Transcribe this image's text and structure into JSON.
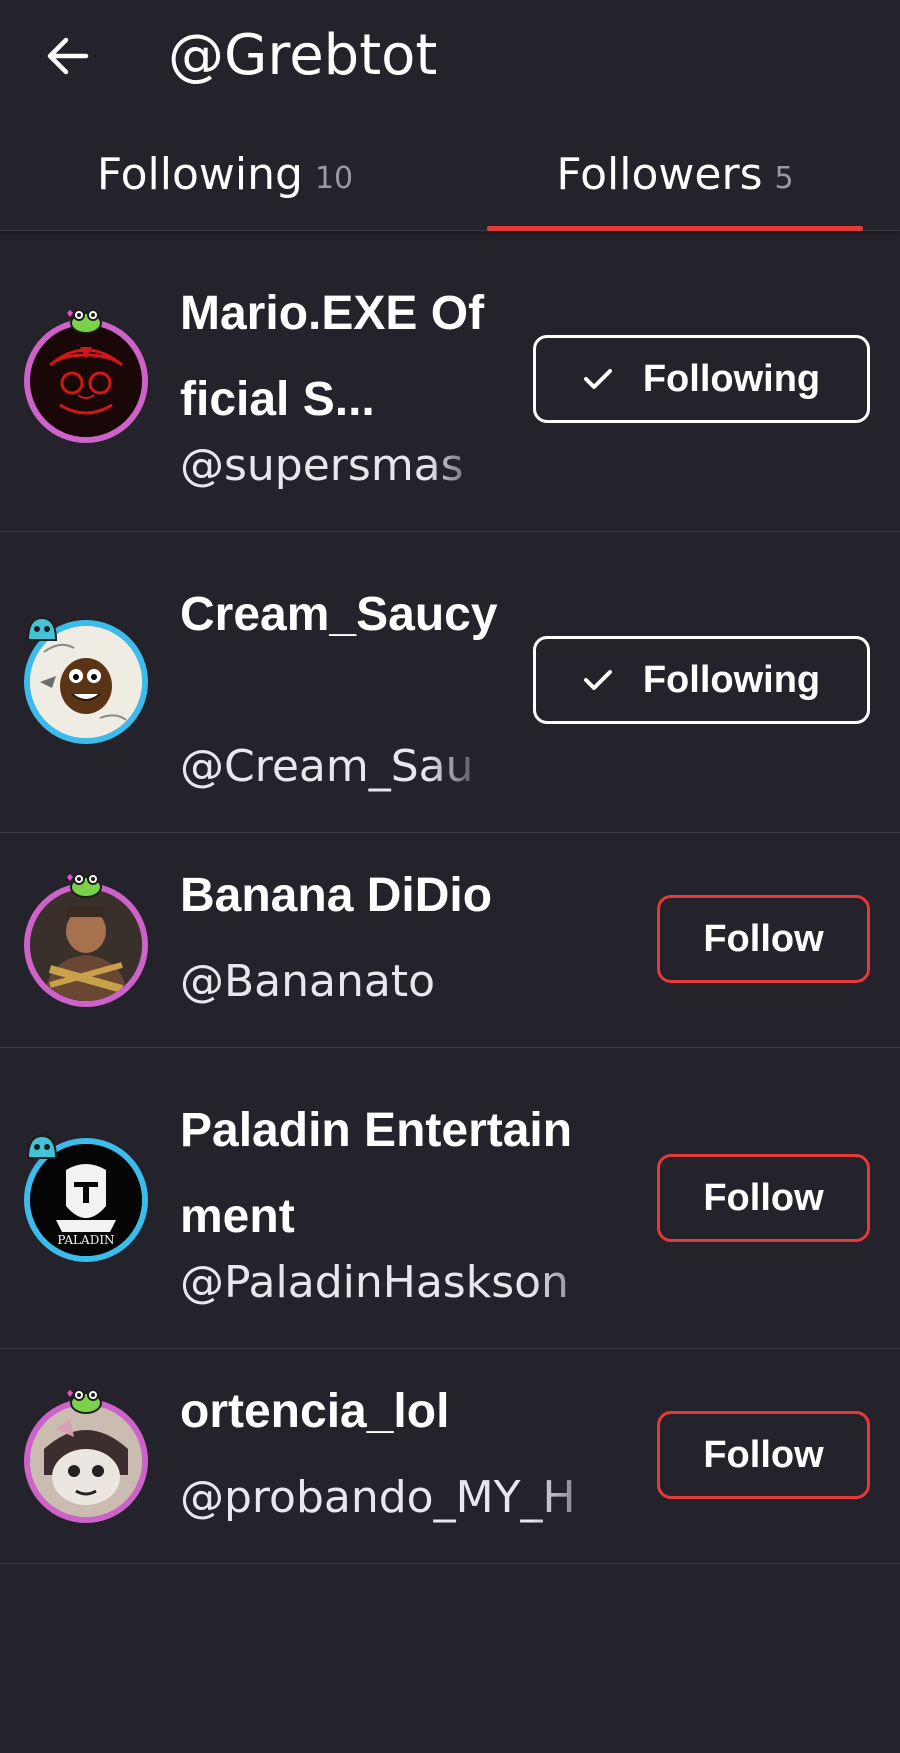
{
  "header": {
    "title": "@Grebtot",
    "back_icon": "arrow-left-icon"
  },
  "tabs": [
    {
      "label": "Following",
      "count": "10",
      "active": false
    },
    {
      "label": "Followers",
      "count": "5",
      "active": true
    }
  ],
  "colors": {
    "background": "#24232b",
    "accent": "#e5393a",
    "ring_pink": "#cd62c9",
    "ring_blue": "#3dbbea"
  },
  "users": [
    {
      "name": "Mario.EXE Official S...",
      "handle": "@supersmas",
      "button": "Following",
      "button_icon": "check-icon"
    },
    {
      "name": "Cream_Saucy",
      "handle": "@Cream_Sau",
      "button": "Following",
      "button_icon": "check-icon"
    },
    {
      "name": "Banana DiDio",
      "handle": "@Bananato",
      "button": "Follow"
    },
    {
      "name": "Paladin Entertainment",
      "handle": "@PaladinHaskson",
      "button": "Follow",
      "avatar_text": "PALADIN"
    },
    {
      "name": "ortencia_lol",
      "handle": "@probando_MY_H",
      "button": "Follow"
    }
  ]
}
